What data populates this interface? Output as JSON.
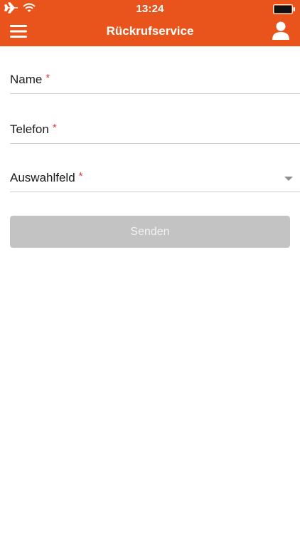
{
  "status_bar": {
    "time": "13:24",
    "icons": [
      "airplane-icon",
      "wifi-icon",
      "battery-icon"
    ]
  },
  "nav": {
    "title": "Rückrufservice",
    "left_icon": "hamburger-menu-icon",
    "right_icon": "user-profile-icon"
  },
  "form": {
    "name": {
      "label": "Name",
      "required_mark": "*"
    },
    "phone": {
      "label": "Telefon",
      "required_mark": "*"
    },
    "select": {
      "label": "Auswahlfeld",
      "required_mark": "*"
    },
    "submit_label": "Senden"
  },
  "colors": {
    "brand": "#e8541c",
    "required": "#e03a3a",
    "button_disabled": "#c3c3c3"
  }
}
